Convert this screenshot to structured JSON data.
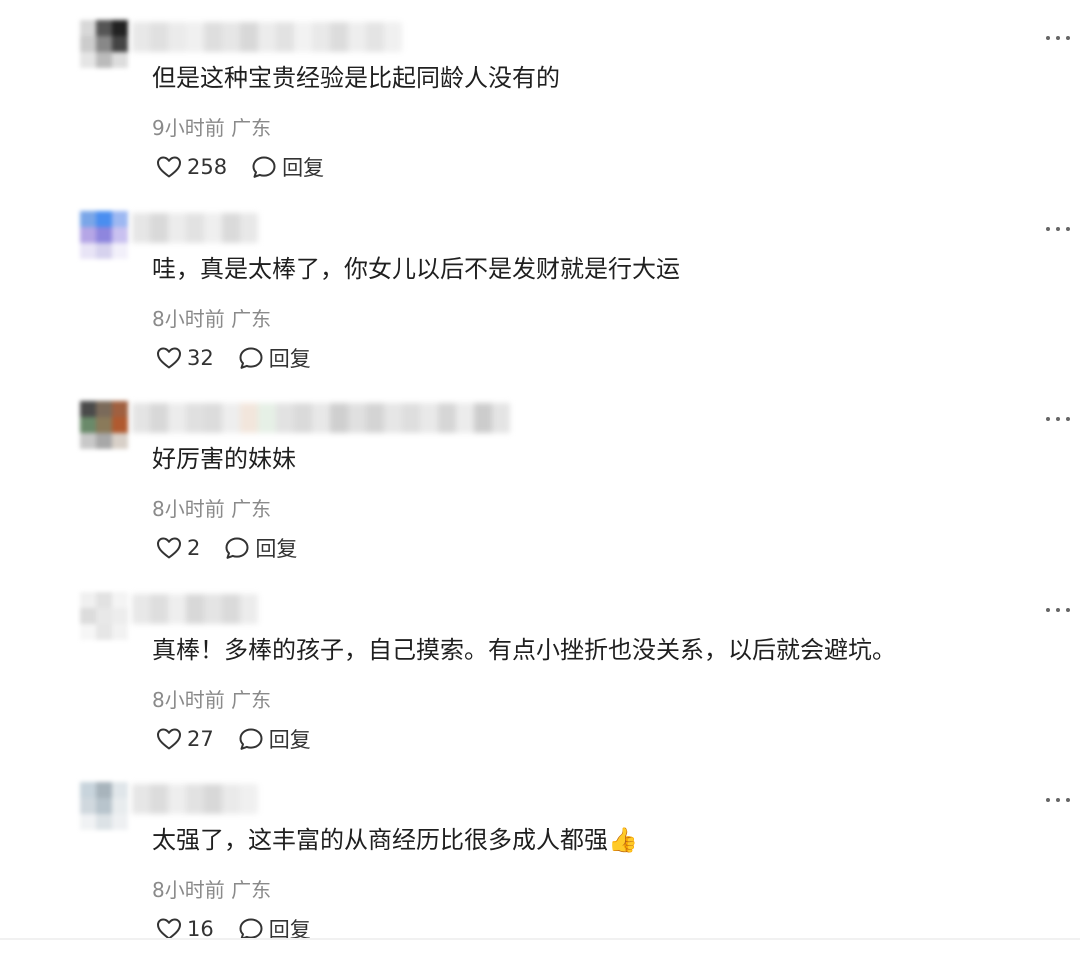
{
  "comments": [
    {
      "text": "但是这种宝贵经验是比起同龄人没有的",
      "time": "9小时前",
      "location": "广东",
      "likes": "258",
      "reply_label": "回复",
      "avatar_colors": [
        "#d8d8d8",
        "#555",
        "#222",
        "#ccc",
        "#888",
        "#444",
        "#e5e5e5",
        "#bbb",
        "#ddd"
      ],
      "name_colors": [
        "#e8e8e8",
        "#e0e0e0",
        "#ebebeb",
        "#f0f0f0",
        "#dedede",
        "#e6e6e6",
        "#d8d8d8",
        "#ececec",
        "#e2e2e2",
        "#f2f2f2",
        "#e9e9e9",
        "#dcdcdc",
        "#eeeeee",
        "#e4e4e4",
        "#f0f0f0"
      ]
    },
    {
      "text": "哇，真是太棒了，你女儿以后不是发财就是行大运",
      "time": "8小时前",
      "location": "广东",
      "likes": "32",
      "reply_label": "回复",
      "avatar_colors": [
        "#7aa6e8",
        "#4a8ef0",
        "#9db8f2",
        "#b5a6e6",
        "#8e86de",
        "#c9c1f0",
        "#e8e4f6",
        "#d6d2ee",
        "#f2f0fa"
      ],
      "name_colors": [
        "#e6e6e6",
        "#d9d9d9",
        "#ececec",
        "#e2e2e2",
        "#efefef",
        "#dadada",
        "#e8e8e8"
      ]
    },
    {
      "text": "好厉害的妹妹",
      "time": "8小时前",
      "location": "广东",
      "likes": "2",
      "reply_label": "回复",
      "avatar_colors": [
        "#4a4a4a",
        "#7a6a5a",
        "#a06040",
        "#6a8a6a",
        "#8a7a5a",
        "#b05a30",
        "#c8c8c8",
        "#a8a8a8",
        "#d8d0c8"
      ],
      "name_colors": [
        "#e4e4e4",
        "#d8d8d8",
        "#ececec",
        "#e0e0e0",
        "#dcdcdc",
        "#eeeeee",
        "#f2e6dc",
        "#e6f0e6",
        "#e2e2e2",
        "#dadada",
        "#e8e8e8",
        "#cfcfcf",
        "#e0e0e0",
        "#d4d4d4",
        "#e6e6e6",
        "#dedede",
        "#e9e9e9",
        "#d6d6d6",
        "#ececec",
        "#cccccc",
        "#e4e4e4"
      ]
    },
    {
      "text": "真棒！多棒的孩子，自己摸索。有点小挫折也没关系，以后就会避坑。",
      "time": "8小时前",
      "location": "广东",
      "likes": "27",
      "reply_label": "回复",
      "avatar_colors": [
        "#f0f0f0",
        "#e2e2e2",
        "#f4f4f4",
        "#dcdcdc",
        "#e8e8e8",
        "#ededed",
        "#f6f6f6",
        "#e6e6e6",
        "#f2f2f2"
      ],
      "name_colors": [
        "#e8e8e8",
        "#dedede",
        "#eeeeee",
        "#d8d8d8",
        "#e4e4e4",
        "#dadada",
        "#ececec"
      ]
    },
    {
      "text": "太强了，这丰富的从商经历比很多成人都强👍",
      "time": "8小时前",
      "location": "广东",
      "likes": "16",
      "reply_label": "回复",
      "avatar_colors": [
        "#c8d4dc",
        "#a8b4bc",
        "#e0e6ea",
        "#d0d8de",
        "#b8c4cc",
        "#e8ecee",
        "#f0f2f4",
        "#dce2e6",
        "#eef0f2"
      ],
      "name_colors": [
        "#e6e6e6",
        "#dcdcdc",
        "#eeeeee",
        "#e2e2e2",
        "#d8d8d8",
        "#eaeaea",
        "#f0f0f0"
      ]
    }
  ]
}
